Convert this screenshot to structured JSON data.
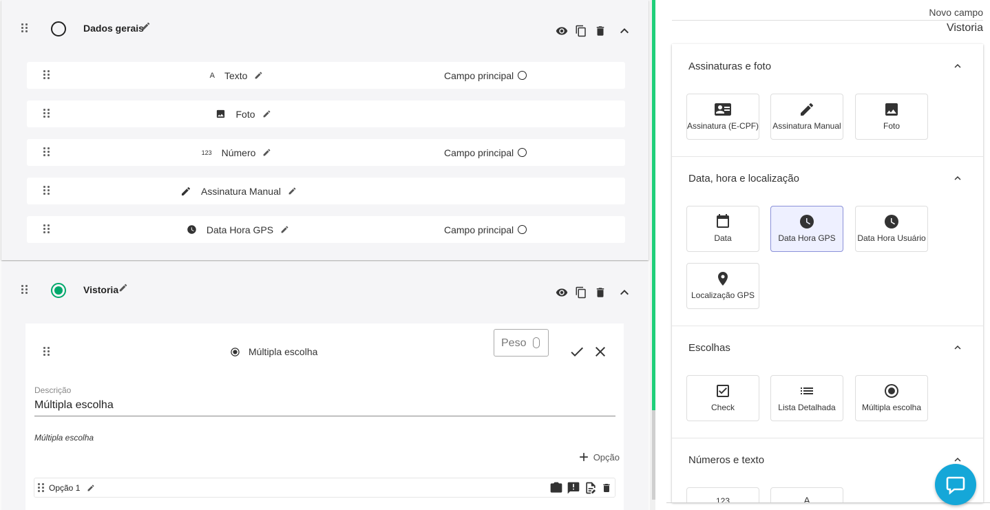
{
  "sections": [
    {
      "title": "Dados gerais",
      "active": false,
      "fields": [
        {
          "icon": "text-icon",
          "label": "Texto",
          "main": "Campo principal"
        },
        {
          "icon": "image-icon",
          "label": "Foto",
          "main": ""
        },
        {
          "icon": "number-icon",
          "label": "Número",
          "main": "Campo principal"
        },
        {
          "icon": "signature-icon",
          "label": "Assinatura Manual",
          "main": ""
        },
        {
          "icon": "clock-icon",
          "label": "Data Hora GPS",
          "main": "Campo principal"
        }
      ]
    },
    {
      "title": "Vistoria",
      "active": true,
      "editor": {
        "field_label": "Múltipla escolha",
        "peso_placeholder": "Peso",
        "desc_label": "Descrição",
        "desc_value": "Múltipla escolha",
        "type_label": "Múltipla escolha",
        "add_option_label": "Opção",
        "options": [
          {
            "label": "Opção 1"
          }
        ]
      }
    }
  ],
  "right": {
    "novo_campo": "Novo campo",
    "section_name": "Vistoria",
    "groups": [
      {
        "title": "Assinaturas e foto",
        "tiles": [
          {
            "icon": "id-card-icon",
            "label": "Assinatura (E-CPF)"
          },
          {
            "icon": "signature-icon",
            "label": "Assinatura Manual"
          },
          {
            "icon": "image-icon",
            "label": "Foto"
          }
        ]
      },
      {
        "title": "Data, hora e localização",
        "tiles": [
          {
            "icon": "calendar-icon",
            "label": "Data"
          },
          {
            "icon": "clock-icon",
            "label": "Data Hora GPS",
            "selected": true
          },
          {
            "icon": "clock-icon",
            "label": "Data Hora Usuário"
          },
          {
            "icon": "location-pin-icon",
            "label": "Localização GPS"
          }
        ]
      },
      {
        "title": "Escolhas",
        "tiles": [
          {
            "icon": "checkbox-icon",
            "label": "Check"
          },
          {
            "icon": "list-icon",
            "label": "Lista Detalhada"
          },
          {
            "icon": "radio-icon",
            "label": "Múltipla escolha"
          }
        ]
      },
      {
        "title": "Números e texto",
        "tiles": [
          {
            "icon": "number-icon",
            "label": ""
          },
          {
            "icon": "text-icon",
            "label": ""
          }
        ]
      }
    ]
  },
  "colors": {
    "accent_green": "#1fcf7a",
    "active_radio": "#00a86b",
    "chat_blue": "#15a7d8",
    "selected_tile": "#eef0ff"
  }
}
